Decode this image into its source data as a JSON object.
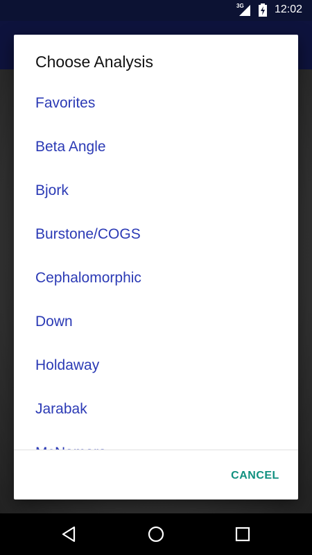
{
  "status_bar": {
    "network": "3G",
    "time": "12:02"
  },
  "dialog": {
    "title": "Choose Analysis",
    "items": [
      {
        "label": "Favorites"
      },
      {
        "label": "Beta Angle"
      },
      {
        "label": "Bjork"
      },
      {
        "label": "Burstone/COGS"
      },
      {
        "label": "Cephalomorphic"
      },
      {
        "label": "Down"
      },
      {
        "label": "Holdaway"
      },
      {
        "label": "Jarabak"
      },
      {
        "label": "McNamara"
      }
    ],
    "cancel_label": "CANCEL"
  },
  "colors": {
    "item_text": "#2b3ab5",
    "accent": "#10907f",
    "status_bar": "#0c1233",
    "app_bar": "#131a52"
  },
  "nav_bar": {
    "back": "back-icon",
    "home": "home-icon",
    "recents": "recents-icon"
  }
}
